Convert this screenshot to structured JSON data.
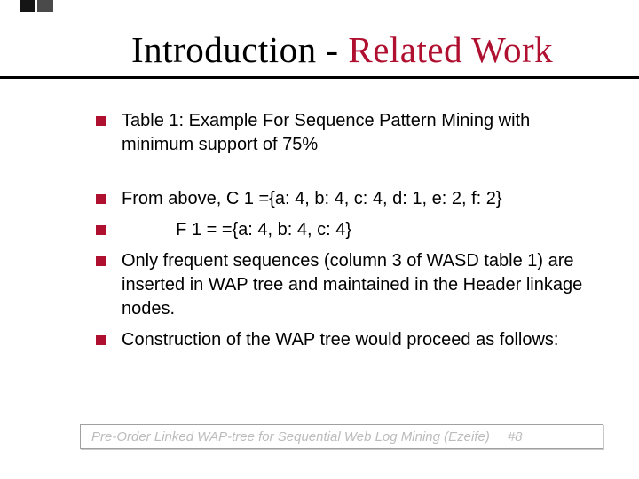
{
  "title": {
    "intro": "Introduction - ",
    "related": "Related Work"
  },
  "bullets": {
    "b1": "Table 1: Example For Sequence Pattern Mining with minimum support of 75%",
    "b2": "From above, C 1 ={a: 4, b: 4, c: 4, d: 1, e: 2, f: 2}",
    "b3": "           F 1 = ={a: 4, b: 4, c: 4}",
    "b4": "Only frequent sequences (column 3 of WASD table 1) are inserted in WAP tree and maintained in the Header linkage nodes.",
    "b5": "Construction of the WAP tree would proceed as follows:"
  },
  "footer": {
    "text": "Pre-Order Linked WAP-tree for Sequential Web Log Mining (Ezeife)",
    "page": "#8"
  }
}
